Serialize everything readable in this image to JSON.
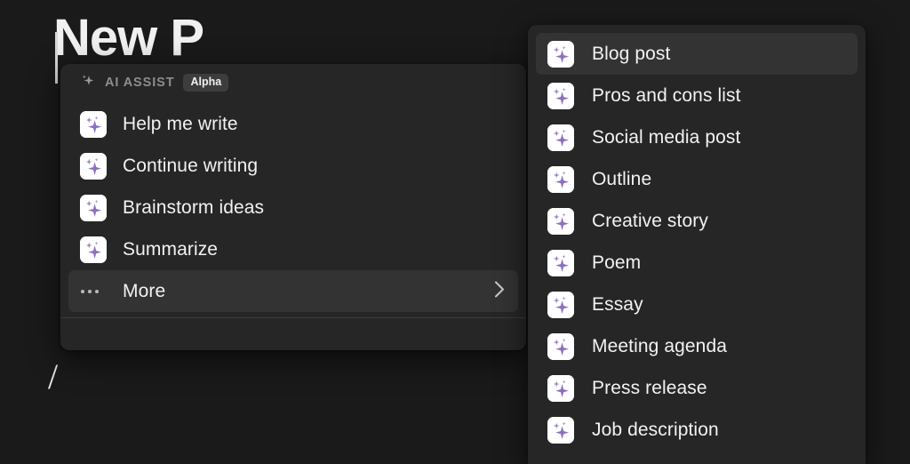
{
  "background": {
    "document_title": "New P",
    "slash_command": "/",
    "page_bg": "#1a1a1a"
  },
  "ai_assist_menu": {
    "header": {
      "icon": "sparkle-icon",
      "label": "AI ASSIST",
      "badge": "Alpha"
    },
    "items": [
      {
        "icon": "sparkle-icon",
        "label": "Help me write",
        "active": false,
        "has_submenu": false
      },
      {
        "icon": "sparkle-icon",
        "label": "Continue writing",
        "active": false,
        "has_submenu": false
      },
      {
        "icon": "sparkle-icon",
        "label": "Brainstorm ideas",
        "active": false,
        "has_submenu": false
      },
      {
        "icon": "sparkle-icon",
        "label": "Summarize",
        "active": false,
        "has_submenu": false
      },
      {
        "icon": "ellipsis-icon",
        "label": "More",
        "active": true,
        "has_submenu": true
      }
    ]
  },
  "more_submenu": {
    "items": [
      {
        "icon": "sparkle-icon",
        "label": "Blog post",
        "active": true
      },
      {
        "icon": "sparkle-icon",
        "label": "Pros and cons list",
        "active": false
      },
      {
        "icon": "sparkle-icon",
        "label": "Social media post",
        "active": false
      },
      {
        "icon": "sparkle-icon",
        "label": "Outline",
        "active": false
      },
      {
        "icon": "sparkle-icon",
        "label": "Creative story",
        "active": false
      },
      {
        "icon": "sparkle-icon",
        "label": "Poem",
        "active": false
      },
      {
        "icon": "sparkle-icon",
        "label": "Essay",
        "active": false
      },
      {
        "icon": "sparkle-icon",
        "label": "Meeting agenda",
        "active": false
      },
      {
        "icon": "sparkle-icon",
        "label": "Press release",
        "active": false
      },
      {
        "icon": "sparkle-icon",
        "label": "Job description",
        "active": false
      }
    ]
  },
  "colors": {
    "menu_bg": "#262626",
    "row_hover_bg": "#333333",
    "accent_purple": "#8e6fbf",
    "text_primary": "#f2f2f2",
    "text_muted": "#8d8d8d"
  }
}
